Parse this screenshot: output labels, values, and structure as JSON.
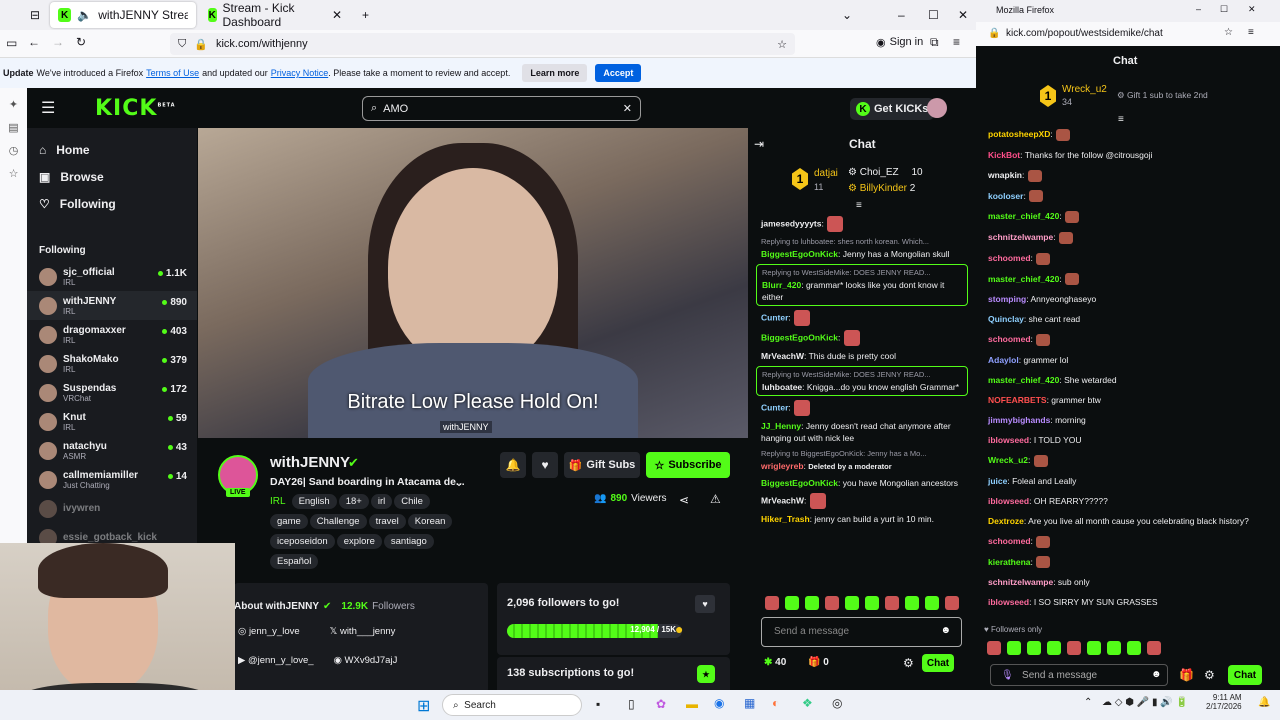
{
  "browser1": {
    "tabs": [
      {
        "label": "withJENNY Stream - Watch"
      },
      {
        "label": "Stream - Kick Dashboard"
      }
    ],
    "url": "kick.com/withjenny",
    "sign_in": "Sign in",
    "notice": {
      "prefix": "Update",
      "text1": "We've introduced a Firefox",
      "link1": "Terms of Use",
      "text2": "and updated our",
      "link2": "Privacy Notice",
      "text3": ". Please take a moment to review and accept.",
      "learn": "Learn more",
      "accept": "Accept"
    }
  },
  "kick": {
    "logo": "KICK",
    "logo_badge": "BETA",
    "search_value": "AMO",
    "get_kicks": "Get KICKs",
    "nav": [
      {
        "label": "Home"
      },
      {
        "label": "Browse"
      },
      {
        "label": "Following"
      }
    ],
    "following_title": "Following",
    "following": [
      {
        "name": "sjc_official",
        "cat": "IRL",
        "count": "1.1K"
      },
      {
        "name": "withJENNY",
        "cat": "IRL",
        "count": "890"
      },
      {
        "name": "dragomaxxer",
        "cat": "IRL",
        "count": "403"
      },
      {
        "name": "ShakoMako",
        "cat": "IRL",
        "count": "379"
      },
      {
        "name": "Suspendas",
        "cat": "VRChat",
        "count": "172"
      },
      {
        "name": "Knut",
        "cat": "IRL",
        "count": "59"
      },
      {
        "name": "natachyu",
        "cat": "ASMR",
        "count": "43"
      },
      {
        "name": "callmemiamiller",
        "cat": "Just Chatting",
        "count": "14"
      },
      {
        "name": "ivywren",
        "cat": "",
        "count": ""
      },
      {
        "name": "essie_gotback_kick",
        "cat": "",
        "count": ""
      }
    ],
    "video_overlay": "Bitrate Low Please Hold On!",
    "video_tag": "withJENNY",
    "streamer": {
      "name": "withJENNY",
      "live": "LIVE",
      "title": "DAY26| Sand boarding in Atacama de...",
      "category": "IRL",
      "tags": [
        "English",
        "18+",
        "irl",
        "Chile",
        "game",
        "Challenge",
        "travel",
        "Korean",
        "iceposeidon",
        "explore",
        "santiago",
        "Español"
      ],
      "viewers": "890",
      "viewers_label": "Viewers",
      "gift": "Gift Subs",
      "subscribe": "Subscribe"
    },
    "about": {
      "title": "About withJENNY",
      "followers": "12.9K",
      "followers_label": "Followers",
      "socials": [
        "jenn_y_love",
        "with___jenny",
        "@jenn_y_love_",
        "WXv9dJ7ajJ"
      ]
    },
    "goal1": {
      "title": "2,096 followers to go!",
      "progress": "12,904 / 15K",
      "fraction": 0.86
    },
    "goal2": {
      "title": "138 subscriptions to go!"
    },
    "chat": {
      "title": "Chat",
      "top": [
        {
          "rank": "1",
          "name": "datjai",
          "count": "11"
        },
        {
          "name": "Choi_EZ",
          "count": "10"
        },
        {
          "name": "BillyKinder",
          "count": "2"
        }
      ],
      "messages": [
        {
          "user": "jamesedyyyyts",
          "text": "",
          "color": "#efeff1"
        },
        {
          "reply": "Replying to luhboatee: shes north korean. Which...",
          "user": "BiggestEgoOnKick",
          "text": "Jenny has a Mongolian skull",
          "color": "#53fc18"
        },
        {
          "reply": "Replying to WestSideMike: DOES JENNY READ...",
          "user": "Blurr_420",
          "text": "grammar* looks like you dont know it either",
          "color": "#53fc18",
          "hl": true
        },
        {
          "user": "Cunter",
          "text": "",
          "color": "#8fd0ff"
        },
        {
          "user": "BiggestEgoOnKick",
          "text": "",
          "color": "#53fc18"
        },
        {
          "user": "MrVeachW",
          "text": "This dude is pretty cool",
          "color": "#efeff1"
        },
        {
          "reply": "Replying to WestSideMike: DOES JENNY READ...",
          "user": "luhboatee",
          "text": "Knigga...do you know english Grammar*",
          "color": "#efeff1",
          "hl": true
        },
        {
          "user": "Cunter",
          "text": "",
          "color": "#8fd0ff"
        },
        {
          "user": "JJ_Henny",
          "text": "Jenny doesn't read chat anymore after hanging out with nick lee",
          "color": "#53fc18"
        },
        {
          "reply": "Replying to BiggestEgoOnKick: Jenny has a Mo...",
          "user": "wrigleyreb",
          "text": "Deleted by a moderator",
          "color": "#ff6b6b"
        },
        {
          "user": "BiggestEgoOnKick",
          "text": "you have Mongolian ancestors",
          "color": "#53fc18"
        },
        {
          "user": "MrVeachW",
          "text": "",
          "color": "#efeff1"
        },
        {
          "user": "Hiker_Trash",
          "text": "jenny can build a yurt in 10 min.",
          "color": "#ffd400"
        }
      ],
      "placeholder": "Send a message",
      "points": "40",
      "zero": "0",
      "send": "Chat"
    }
  },
  "browser2": {
    "title": "Mozilla Firefox",
    "url": "kick.com/popout/westsidemike/chat",
    "chat_title": "Chat",
    "top": {
      "rank": "1",
      "name": "Wreck_u2",
      "count": "34",
      "gift": "Gift 1 sub to take 2nd"
    },
    "messages": [
      {
        "user": "potatosheepXD",
        "text": "",
        "color": "#ffd400"
      },
      {
        "user": "KickBot",
        "text": "Thanks for the follow @citrousgoji",
        "color": "#ff4f8b"
      },
      {
        "user": "wnapkin",
        "text": "",
        "color": "#efeff1"
      },
      {
        "user": "kooloser",
        "text": "",
        "color": "#8fd0ff"
      },
      {
        "user": "master_chief_420",
        "text": "",
        "color": "#53fc18"
      },
      {
        "user": "schnitzelwampe",
        "text": "",
        "color": "#ff9ec8"
      },
      {
        "user": "schoomed",
        "text": "",
        "color": "#ff6b9e"
      },
      {
        "user": "master_chief_420",
        "text": "",
        "color": "#53fc18"
      },
      {
        "user": "stomping",
        "text": "Annyeonghaseyo",
        "color": "#b98cff"
      },
      {
        "user": "Quinclay",
        "text": "she cant read",
        "color": "#8fd0ff"
      },
      {
        "user": "schoomed",
        "text": "",
        "color": "#ff6b9e"
      },
      {
        "user": "Adaylol",
        "text": "grammer lol",
        "color": "#8fa0ff"
      },
      {
        "user": "master_chief_420",
        "text": "She wetarded",
        "color": "#53fc18"
      },
      {
        "user": "NOFEARBETS",
        "text": "grammer btw",
        "color": "#ff4f4f"
      },
      {
        "user": "jimmybighands",
        "text": "morning",
        "color": "#b98cff"
      },
      {
        "user": "iblowseed",
        "text": "I TOLD YOU",
        "color": "#ff6b9e"
      },
      {
        "user": "Wreck_u2",
        "text": "",
        "color": "#53fc18"
      },
      {
        "user": "juice",
        "text": "Foleal and Leally",
        "color": "#8fd0ff"
      },
      {
        "user": "iblowseed",
        "text": "OH REARRY?????",
        "color": "#ff6b9e"
      },
      {
        "user": "Dextroze",
        "text": "Are you live all month cause you celebrating black history?",
        "color": "#ffd400"
      },
      {
        "user": "schoomed",
        "text": "",
        "color": "#ff6b9e"
      },
      {
        "user": "kierathena",
        "text": "",
        "color": "#53fc18"
      },
      {
        "user": "schnitzelwampe",
        "text": "sub only",
        "color": "#ff9ec8"
      },
      {
        "user": "iblowseed",
        "text": "I SO SIRRY MY SUN GRASSES",
        "color": "#ff6b9e"
      }
    ],
    "followers_only": "Followers only",
    "placeholder": "Send a message",
    "send": "Chat"
  },
  "taskbar": {
    "search": "Search",
    "time": "9:11 AM",
    "date": "2/17/2026"
  }
}
